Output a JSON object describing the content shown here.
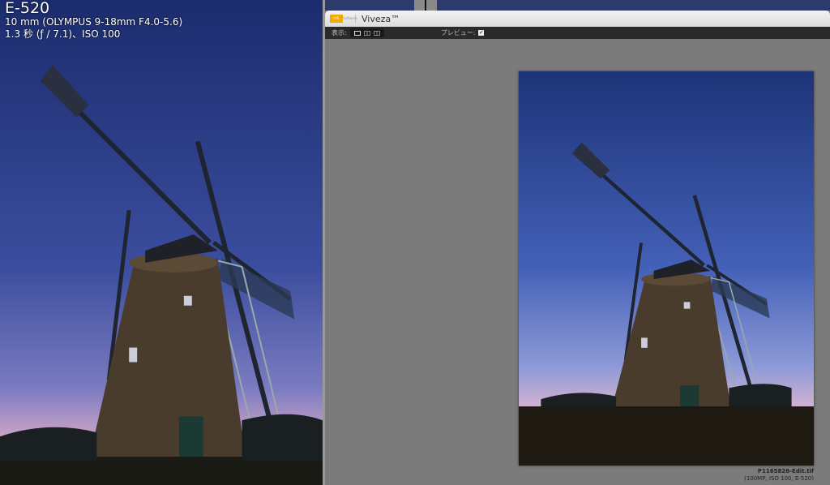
{
  "exif": {
    "model": "E-520",
    "lens": "10 mm (OLYMPUS 9-18mm F4.0-5.6)",
    "exposure": "1.3 秒 (ƒ / 7.1)、ISO 100"
  },
  "window": {
    "logo": "nik",
    "logo_sub": "Software",
    "title": "Viveza™"
  },
  "toolbar": {
    "view_label": "表示:",
    "preview_label": "プレビュー:",
    "preview_checked": true,
    "check_mark": "✓"
  },
  "caption": {
    "filename": "P1165826-Edit.tif",
    "info": "(100MP, ISO 100, E-520)"
  },
  "colors": {
    "sky_top": "#1d2f70",
    "sky_bottom": "#d6a7c8",
    "accent": "#f2a900"
  }
}
